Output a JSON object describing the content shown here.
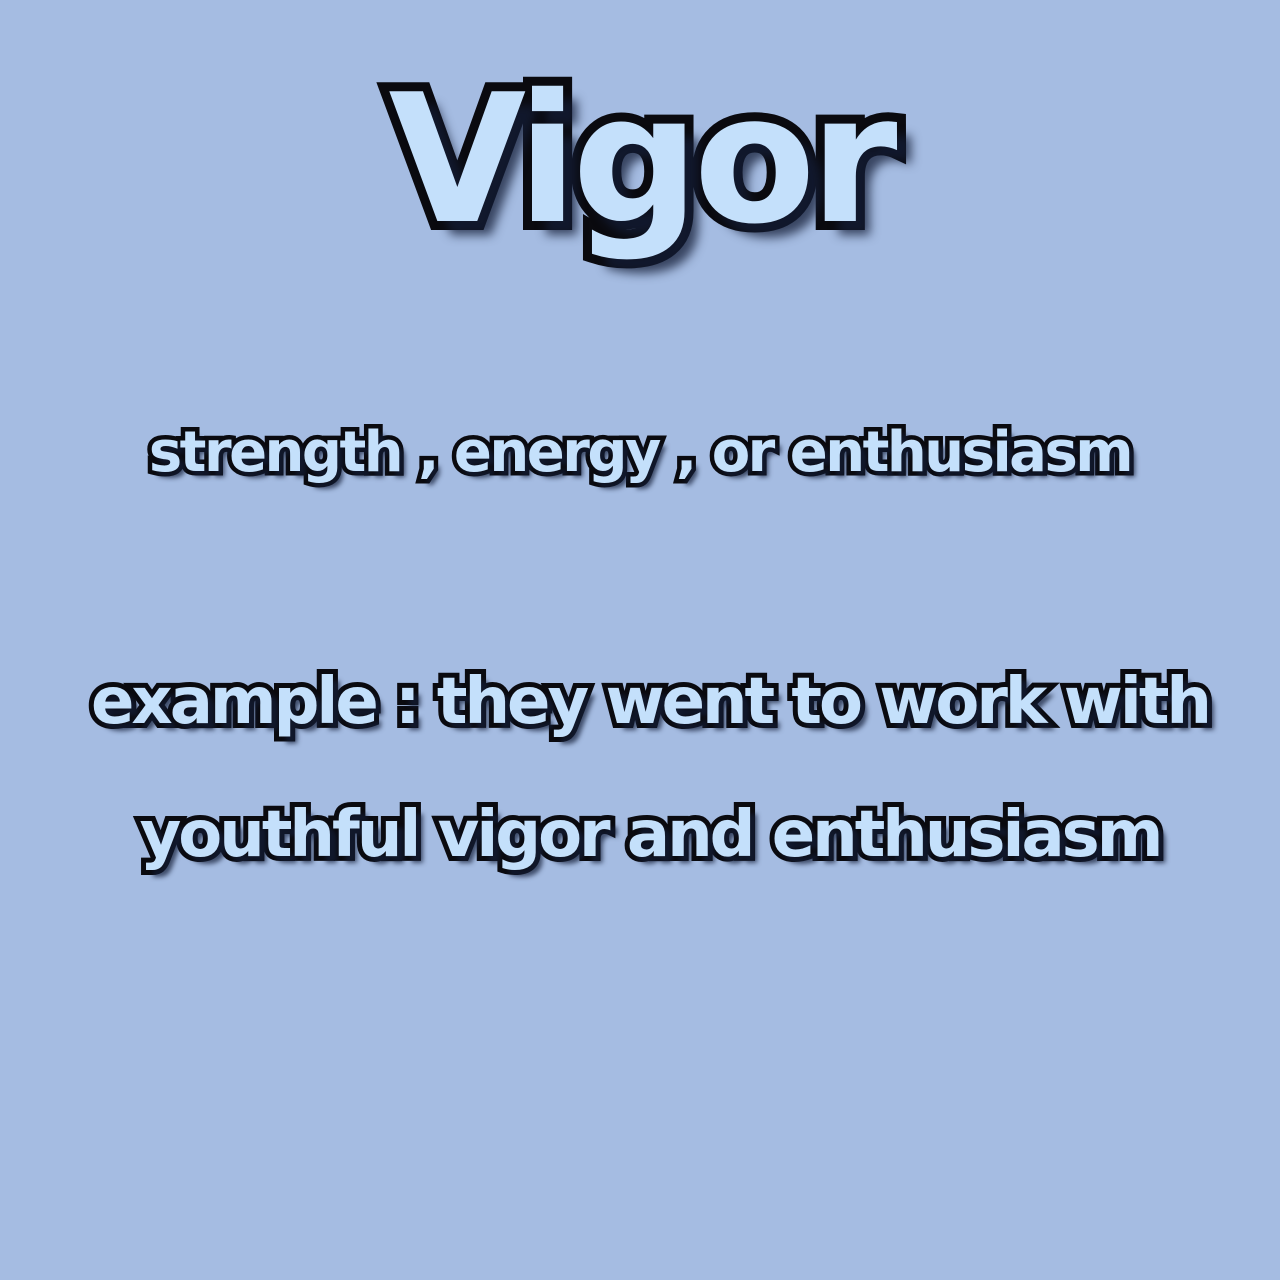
{
  "word": "Vigor",
  "definition": "strength , energy , or enthusiasm",
  "example": {
    "line1": "example : they went to work with",
    "line2": "youthful vigor and enthusiasm"
  },
  "colors": {
    "background": "#a5bce2",
    "text_fill": "#c4e0fb",
    "text_outline": "#0a0a0f"
  }
}
